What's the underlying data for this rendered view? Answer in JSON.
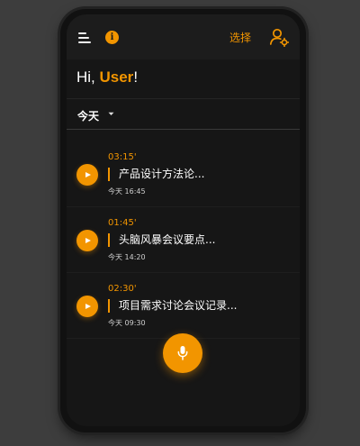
{
  "header": {
    "info_label": "i",
    "select_label": "选择"
  },
  "greeting": {
    "prefix": "Hi, ",
    "name": "User",
    "suffix": "!"
  },
  "filter": {
    "label": "今天"
  },
  "recordings": [
    {
      "duration": "03:15'",
      "title": "产品设计方法论...",
      "time": "今天 16:45"
    },
    {
      "duration": "01:45'",
      "title": "头脑风暴会议要点...",
      "time": "今天 14:20"
    },
    {
      "duration": "02:30'",
      "title": "项目需求讨论会议记录...",
      "time": "今天 09:30"
    }
  ],
  "colors": {
    "accent": "#f29500",
    "background": "#161616"
  }
}
